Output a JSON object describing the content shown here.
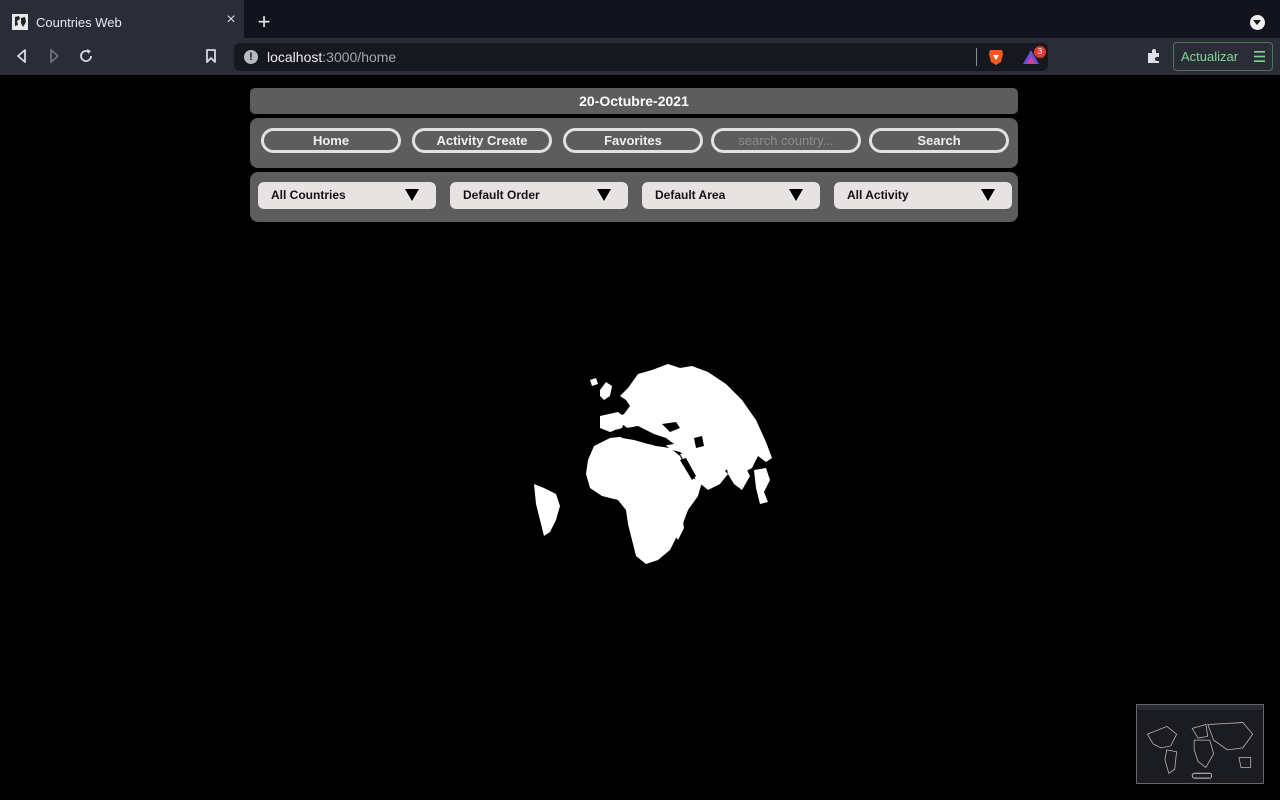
{
  "browser": {
    "tab_title": "Countries Web",
    "tab_close": "×",
    "new_tab": "+",
    "url_host": "localhost",
    "url_path": ":3000/home",
    "info_icon": "!",
    "rewards_badge": "3",
    "update_label": "Actualizar",
    "back_icon": "‹",
    "forward_icon": "›",
    "reload_icon": "↻"
  },
  "header": {
    "date": "20-Octubre-2021"
  },
  "nav": {
    "home": "Home",
    "activity_create": "Activity Create",
    "favorites": "Favorites",
    "search_placeholder": "search country...",
    "search_button": "Search"
  },
  "filters": {
    "countries": "All Countries",
    "order": "Default Order",
    "area": "Default Area",
    "activity": "All Activity"
  },
  "colors": {
    "panel": "#5d5d5d",
    "update_green": "#7dd88e"
  }
}
